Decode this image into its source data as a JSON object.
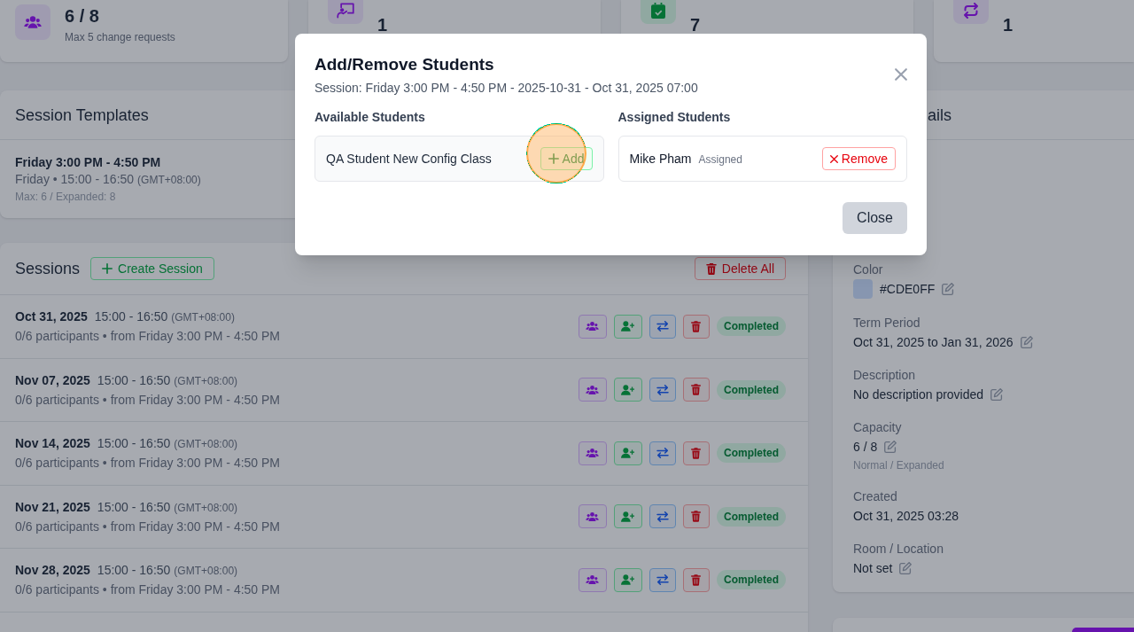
{
  "stats": [
    {
      "kind": "users",
      "value": "6 / 8",
      "note": "Max 5 change requests"
    },
    {
      "kind": "teacher",
      "value": "1"
    },
    {
      "kind": "calendar",
      "value": "7"
    },
    {
      "kind": "repeat",
      "value": "1"
    }
  ],
  "templates": {
    "title": "Session Templates",
    "items": [
      {
        "name": "Friday 3:00 PM - 4:50 PM",
        "schedule": "Friday • 15:00 - 16:50",
        "timezone": "(GMT+08:00)",
        "limits": "Max: 6 / Expanded: 8"
      }
    ]
  },
  "sessions": {
    "title": "Sessions",
    "create_button": "Create Session",
    "delete_all_button": "Delete All",
    "rows": [
      {
        "date": "Oct 31, 2025",
        "time": "15:00 - 16:50",
        "timezone": "(GMT+08:00)",
        "participants": "0/6 participants • from Friday 3:00 PM - 4:50 PM",
        "status": "Completed"
      },
      {
        "date": "Nov 07, 2025",
        "time": "15:00 - 16:50",
        "timezone": "(GMT+08:00)",
        "participants": "0/6 participants • from Friday 3:00 PM - 4:50 PM",
        "status": "Completed"
      },
      {
        "date": "Nov 14, 2025",
        "time": "15:00 - 16:50",
        "timezone": "(GMT+08:00)",
        "participants": "0/6 participants • from Friday 3:00 PM - 4:50 PM",
        "status": "Completed"
      },
      {
        "date": "Nov 21, 2025",
        "time": "15:00 - 16:50",
        "timezone": "(GMT+08:00)",
        "participants": "0/6 participants • from Friday 3:00 PM - 4:50 PM",
        "status": "Completed"
      },
      {
        "date": "Nov 28, 2025",
        "time": "15:00 - 16:50",
        "timezone": "(GMT+08:00)",
        "participants": "0/6 participants • from Friday 3:00 PM - 4:50 PM",
        "status": "Completed"
      }
    ]
  },
  "details": {
    "title": "ails",
    "fields": [
      {
        "kind": "color",
        "label": "Color",
        "value": "#CDE0FF",
        "editable": true
      },
      {
        "kind": "text",
        "label": "Term Period",
        "value": "Oct 31, 2025 to Jan 31, 2026",
        "editable": true
      },
      {
        "kind": "text",
        "label": "Description",
        "value": "No description provided",
        "editable": true
      },
      {
        "kind": "text",
        "label": "Capacity",
        "value": "6 / 8",
        "note": "Normal / Expanded",
        "editable": true
      },
      {
        "kind": "text",
        "label": "Created",
        "value": "Oct 31, 2025 03:28",
        "editable": false
      },
      {
        "kind": "text",
        "label": "Room / Location",
        "value": "Not set",
        "editable": true
      }
    ]
  },
  "modal": {
    "title": "Add/Remove Students",
    "subtitle": "Session: Friday 3:00 PM - 4:50 PM - 2025-10-31 - Oct 31, 2025 07:00",
    "available": {
      "heading": "Available Students",
      "students": [
        {
          "name": "QA Student New Config Class",
          "button": "Add",
          "highlighted": true
        }
      ]
    },
    "assigned": {
      "heading": "Assigned Students",
      "students": [
        {
          "name": "Mike Pham",
          "tag": "Assigned",
          "button": "Remove"
        }
      ]
    },
    "close_button": "Close"
  }
}
